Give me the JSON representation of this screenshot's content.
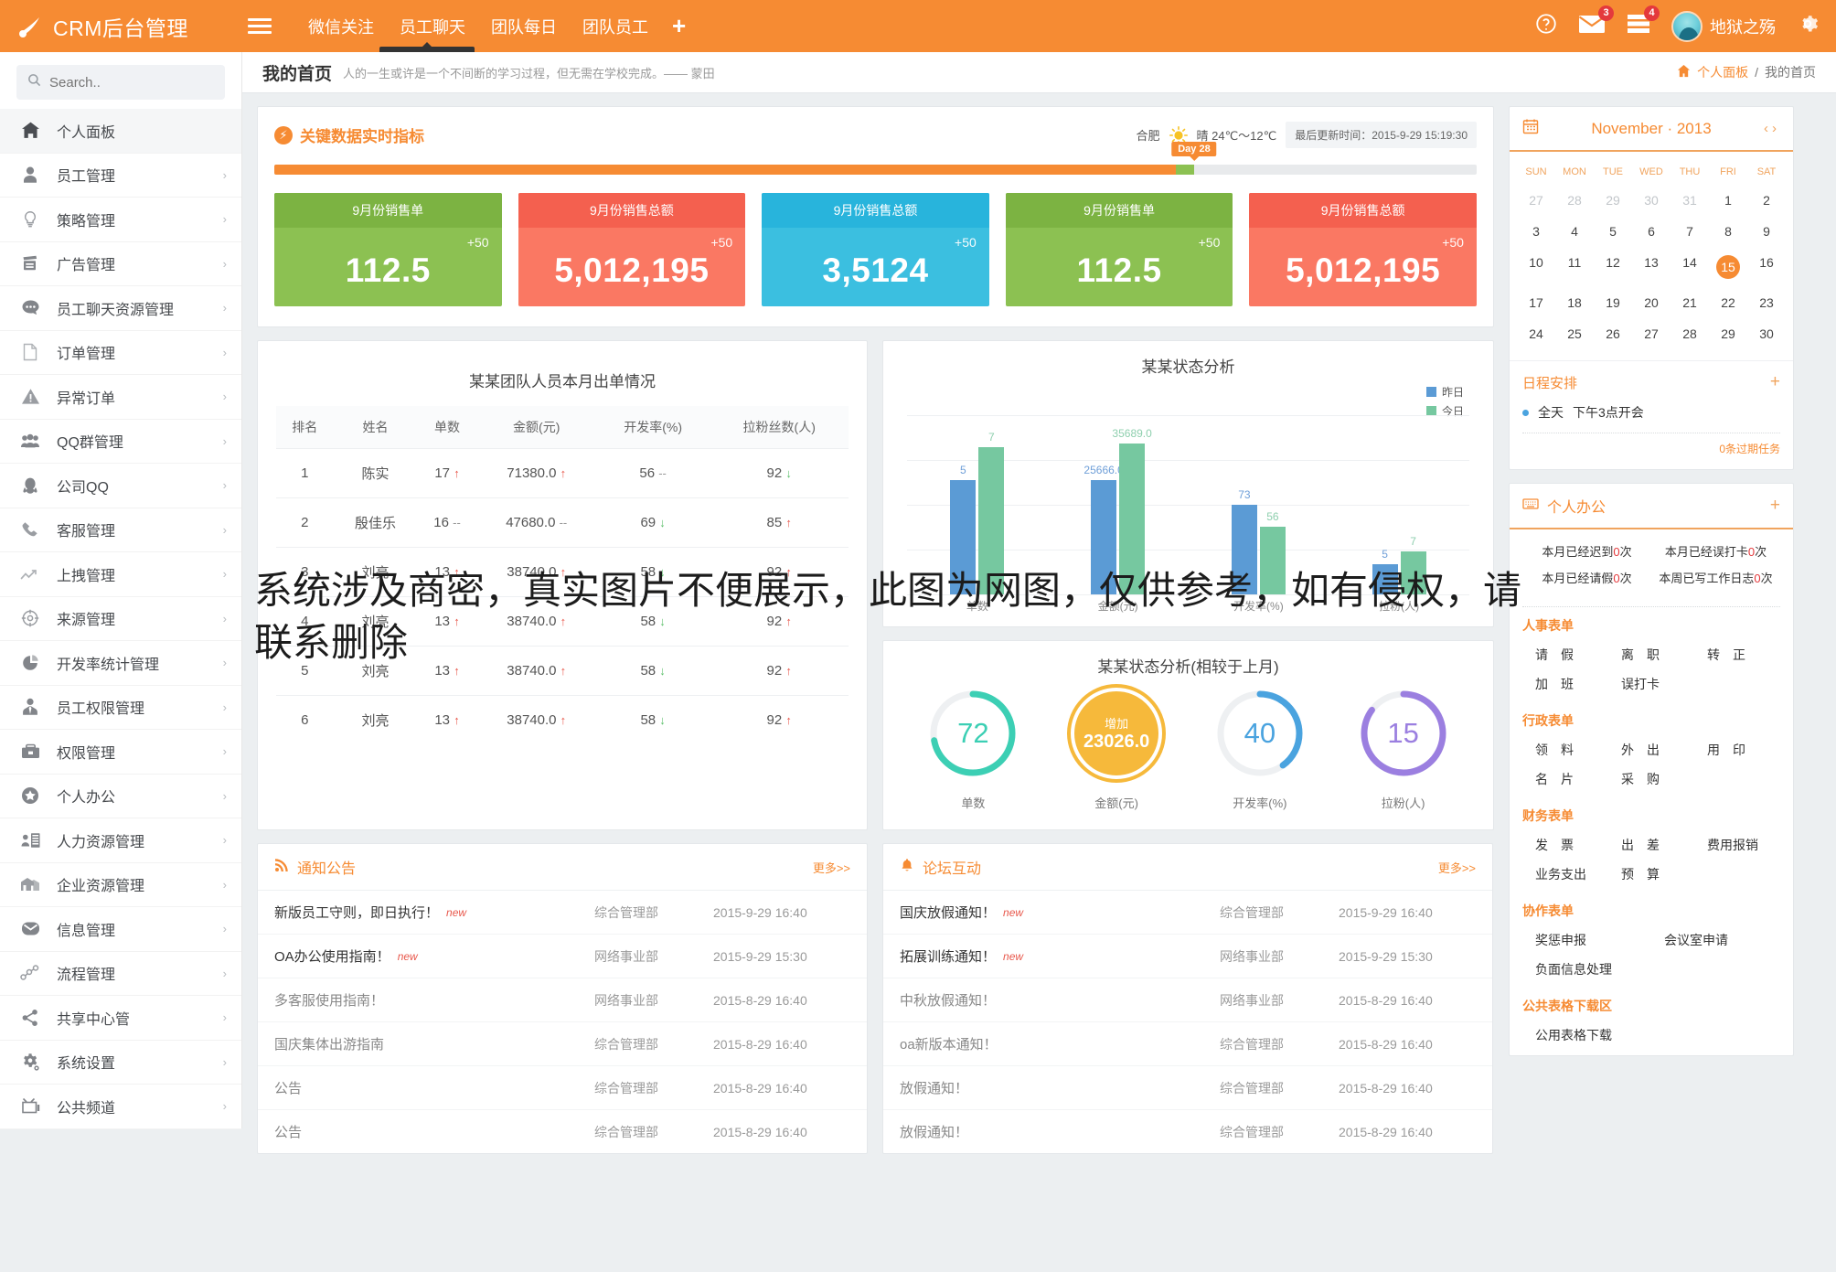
{
  "topbar": {
    "brand": "CRM后台管理",
    "nav": [
      {
        "label": "微信关注"
      },
      {
        "label": "员工聊天"
      },
      {
        "label": "团队每日"
      },
      {
        "label": "团队员工"
      }
    ],
    "add_label": "+",
    "tooltip": "员工聊天资源管理",
    "mail_badge": "3",
    "docs_badge": "4",
    "username": "地狱之殇"
  },
  "sidebar": {
    "search_placeholder": "Search..",
    "items": [
      {
        "label": "个人面板",
        "icon": "home-icon"
      },
      {
        "label": "员工管理",
        "icon": "user-icon"
      },
      {
        "label": "策略管理",
        "icon": "bulb-icon"
      },
      {
        "label": "广告管理",
        "icon": "ad-icon"
      },
      {
        "label": "员工聊天资源管理",
        "icon": "chat-icon"
      },
      {
        "label": "订单管理",
        "icon": "file-icon"
      },
      {
        "label": "异常订单",
        "icon": "warning-icon"
      },
      {
        "label": "QQ群管理",
        "icon": "group-icon"
      },
      {
        "label": "公司QQ",
        "icon": "penguin-icon"
      },
      {
        "label": "客服管理",
        "icon": "phone-icon"
      },
      {
        "label": "上拽管理",
        "icon": "trend-icon"
      },
      {
        "label": "来源管理",
        "icon": "target-icon"
      },
      {
        "label": "开发率统计管理",
        "icon": "pie-icon"
      },
      {
        "label": "员工权限管理",
        "icon": "person-tie-icon"
      },
      {
        "label": "权限管理",
        "icon": "briefcase-icon"
      },
      {
        "label": "个人办公",
        "icon": "star-icon"
      },
      {
        "label": "人力资源管理",
        "icon": "id-card-icon"
      },
      {
        "label": "企业资源管理",
        "icon": "building-icon"
      },
      {
        "label": "信息管理",
        "icon": "envelope-icon"
      },
      {
        "label": "流程管理",
        "icon": "flow-icon"
      },
      {
        "label": "共享中心管",
        "icon": "share-icon"
      },
      {
        "label": "系统设置",
        "icon": "gear-icon"
      },
      {
        "label": "公共频道",
        "icon": "tv-icon"
      }
    ]
  },
  "content_header": {
    "title": "我的首页",
    "subtitle": "人的一生或许是一个不间断的学习过程，但无需在学校完成。—— 蒙田",
    "breadcrumb_home": "个人面板",
    "breadcrumb_sep": "/",
    "breadcrumb_current": "我的首页"
  },
  "kpi_panel": {
    "title": "关键数据实时指标",
    "city": "合肥",
    "weather": "晴 24℃～12℃",
    "updated": "最后更新时间：2015-9-29 15:19:30",
    "progress_flag": "Day 28",
    "progress_percent": 75,
    "cards": [
      {
        "title": "9月份销售单",
        "delta": "+50",
        "value": "112.5",
        "color": "#8cc152",
        "head": "#7cb342"
      },
      {
        "title": "9月份销售总额",
        "delta": "+50",
        "value": "5,012,195",
        "color": "#fa7863",
        "head": "#f4604f"
      },
      {
        "title": "9月份销售总额",
        "delta": "+50",
        "value": "3,5124",
        "color": "#3bbfe0",
        "head": "#28b4dc"
      },
      {
        "title": "9月份销售单",
        "delta": "+50",
        "value": "112.5",
        "color": "#8cc152",
        "head": "#7cb342"
      },
      {
        "title": "9月份销售总额",
        "delta": "+50",
        "value": "5,012,195",
        "color": "#fa7863",
        "head": "#f4604f"
      }
    ]
  },
  "team_table": {
    "title": "某某团队人员本月出单情况",
    "columns": [
      "排名",
      "姓名",
      "单数",
      "金额(元)",
      "开发率(%)",
      "拉粉丝数(人)"
    ],
    "rows": [
      {
        "rank": "1",
        "name": "陈实",
        "orders": "17",
        "orders_t": "up",
        "amount": "71380.0",
        "amount_t": "up",
        "rate": "56",
        "rate_t": "flat",
        "fans": "92",
        "fans_t": "down"
      },
      {
        "rank": "2",
        "name": "殷佳乐",
        "orders": "16",
        "orders_t": "flat",
        "amount": "47680.0",
        "amount_t": "flat",
        "rate": "69",
        "rate_t": "down",
        "fans": "85",
        "fans_t": "up"
      },
      {
        "rank": "3",
        "name": "刘亮",
        "orders": "13",
        "orders_t": "up",
        "amount": "38740.0",
        "amount_t": "up",
        "rate": "58",
        "rate_t": "down",
        "fans": "92",
        "fans_t": "up"
      },
      {
        "rank": "4",
        "name": "刘亮",
        "orders": "13",
        "orders_t": "up",
        "amount": "38740.0",
        "amount_t": "up",
        "rate": "58",
        "rate_t": "down",
        "fans": "92",
        "fans_t": "up"
      },
      {
        "rank": "5",
        "name": "刘亮",
        "orders": "13",
        "orders_t": "up",
        "amount": "38740.0",
        "amount_t": "up",
        "rate": "58",
        "rate_t": "down",
        "fans": "92",
        "fans_t": "up"
      },
      {
        "rank": "6",
        "name": "刘亮",
        "orders": "13",
        "orders_t": "up",
        "amount": "38740.0",
        "amount_t": "up",
        "rate": "58",
        "rate_t": "down",
        "fans": "92",
        "fans_t": "up"
      }
    ]
  },
  "chart_data": [
    {
      "type": "bar",
      "title": "某某状态分析",
      "categories": [
        "单数",
        "金额(元)",
        "开发率(%)",
        "拉粉(人)"
      ],
      "series": [
        {
          "name": "昨日",
          "color": "#5b9bd5",
          "values": [
            5,
            25666.0,
            73,
            5
          ],
          "labels": [
            "5",
            "25666.0",
            "73",
            "5"
          ]
        },
        {
          "name": "今日",
          "color": "#76c8a0",
          "values": [
            7,
            35689.0,
            56,
            7
          ],
          "labels": [
            "7",
            "35689.0",
            "56",
            "7"
          ]
        }
      ],
      "legend_position": "top-right",
      "grid": true,
      "xlabel": "",
      "ylabel": ""
    },
    {
      "type": "pie",
      "title": "某某状态分析(相较于上月)",
      "items": [
        {
          "label": "单数",
          "value": 72,
          "display": "72",
          "percent": 72,
          "color": "#3ccfb4",
          "filled": false
        },
        {
          "label": "金额(元)",
          "value": 23026.0,
          "display": "23026.0",
          "percent": 100,
          "color": "#f6b93b",
          "filled": true,
          "caption": "增加"
        },
        {
          "label": "开发率(%)",
          "value": 40,
          "display": "40",
          "percent": 40,
          "color": "#4aa3df",
          "filled": false
        },
        {
          "label": "拉粉(人)",
          "value": 15,
          "display": "15",
          "percent": 85,
          "color": "#9b7fe0",
          "filled": false
        }
      ]
    }
  ],
  "notices": {
    "title": "通知公告",
    "more": "更多>>",
    "rows": [
      {
        "text": "新版员工守则，即日执行！",
        "new": "new",
        "dept": "综合管理部",
        "date": "2015-9-29 16:40",
        "bold": true
      },
      {
        "text": "OA办公使用指南！",
        "new": "new",
        "dept": "网络事业部",
        "date": "2015-9-29 15:30",
        "bold": true
      },
      {
        "text": "多客服使用指南！",
        "new": "",
        "dept": "网络事业部",
        "date": "2015-8-29 16:40",
        "bold": false
      },
      {
        "text": "国庆集体出游指南",
        "new": "",
        "dept": "综合管理部",
        "date": "2015-8-29 16:40",
        "bold": false
      },
      {
        "text": "公告",
        "new": "",
        "dept": "综合管理部",
        "date": "2015-8-29 16:40",
        "bold": false
      },
      {
        "text": "公告",
        "new": "",
        "dept": "综合管理部",
        "date": "2015-8-29 16:40",
        "bold": false
      }
    ]
  },
  "forum": {
    "title": "论坛互动",
    "more": "更多>>",
    "rows": [
      {
        "text": "国庆放假通知！",
        "new": "new",
        "dept": "综合管理部",
        "date": "2015-9-29 16:40",
        "bold": true
      },
      {
        "text": "拓展训练通知！",
        "new": "new",
        "dept": "网络事业部",
        "date": "2015-9-29 15:30",
        "bold": true
      },
      {
        "text": "中秋放假通知！",
        "new": "",
        "dept": "网络事业部",
        "date": "2015-8-29 16:40",
        "bold": false
      },
      {
        "text": "oa新版本通知！",
        "new": "",
        "dept": "综合管理部",
        "date": "2015-8-29 16:40",
        "bold": false
      },
      {
        "text": "放假通知！",
        "new": "",
        "dept": "综合管理部",
        "date": "2015-8-29 16:40",
        "bold": false
      },
      {
        "text": "放假通知！",
        "new": "",
        "dept": "综合管理部",
        "date": "2015-8-29 16:40",
        "bold": false
      }
    ]
  },
  "calendar": {
    "month": "November · 2013",
    "prev": "‹",
    "next": "›",
    "dow": [
      "SUN",
      "MON",
      "TUE",
      "WED",
      "THU",
      "FRI",
      "SAT"
    ],
    "weeks": [
      [
        {
          "d": "27",
          "m": true
        },
        {
          "d": "28",
          "m": true
        },
        {
          "d": "29",
          "m": true
        },
        {
          "d": "30",
          "m": true
        },
        {
          "d": "31",
          "m": true
        },
        {
          "d": "1"
        },
        {
          "d": "2"
        }
      ],
      [
        {
          "d": "3"
        },
        {
          "d": "4"
        },
        {
          "d": "5"
        },
        {
          "d": "6"
        },
        {
          "d": "7"
        },
        {
          "d": "8"
        },
        {
          "d": "9"
        }
      ],
      [
        {
          "d": "10"
        },
        {
          "d": "11"
        },
        {
          "d": "12"
        },
        {
          "d": "13"
        },
        {
          "d": "14"
        },
        {
          "d": "15",
          "today": true
        },
        {
          "d": "16"
        }
      ],
      [
        {
          "d": "17"
        },
        {
          "d": "18"
        },
        {
          "d": "19"
        },
        {
          "d": "20"
        },
        {
          "d": "21"
        },
        {
          "d": "22"
        },
        {
          "d": "23"
        }
      ],
      [
        {
          "d": "24"
        },
        {
          "d": "25"
        },
        {
          "d": "26"
        },
        {
          "d": "27"
        },
        {
          "d": "28"
        },
        {
          "d": "29"
        },
        {
          "d": "30"
        }
      ]
    ],
    "schedule_title": "日程安排",
    "schedule_add": "+",
    "schedule_items": [
      {
        "when": "全天",
        "what": "下午3点开会"
      }
    ],
    "expired": "0条过期任务"
  },
  "office": {
    "title": "个人办公",
    "add": "+",
    "stats": [
      {
        "prefix": "本月已经迟到",
        "num": "0",
        "suffix": "次"
      },
      {
        "prefix": "本月已经误打卡",
        "num": "0",
        "suffix": "次"
      },
      {
        "prefix": "本月已经请假",
        "num": "0",
        "suffix": "次"
      },
      {
        "prefix": "本周已写工作日志",
        "num": "0",
        "suffix": "次"
      }
    ],
    "groups": [
      {
        "title": "人事表单",
        "links": [
          "请　假",
          "离　职",
          "转　正",
          "加　班",
          "误打卡"
        ],
        "width": "third"
      },
      {
        "title": "行政表单",
        "links": [
          "领　料",
          "外　出",
          "用　印",
          "名　片",
          "采　购"
        ],
        "width": "third"
      },
      {
        "title": "财务表单",
        "links": [
          "发　票",
          "出　差",
          "费用报销",
          "业务支出",
          "预　算"
        ],
        "width": "third"
      },
      {
        "title": "协作表单",
        "links": [
          "奖惩申报",
          "会议室申请",
          "负面信息处理"
        ],
        "width": "wide"
      },
      {
        "title": "公共表格下载区",
        "links": [
          "公用表格下载"
        ],
        "width": "full"
      }
    ]
  },
  "watermark": {
    "line1": "系统涉及商密，真实图片不便展示，此图为网图，仅供参考，如有侵权，请",
    "line2": "联系删除"
  }
}
